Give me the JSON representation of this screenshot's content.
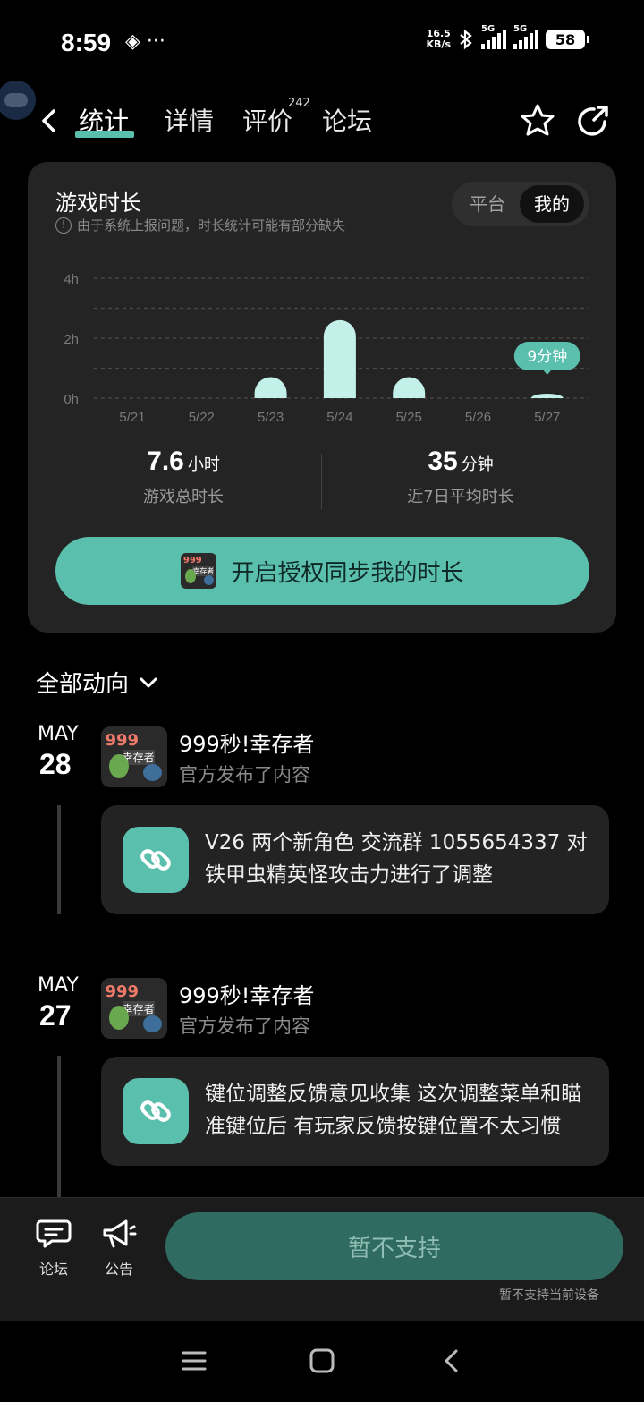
{
  "status_bar": {
    "time": "8:59",
    "left_icons": "◈ ···",
    "net_speed_value": "16.5",
    "net_speed_unit": "KB/s",
    "sim1": "5G",
    "sim2": "5G",
    "battery": "58"
  },
  "nav": {
    "tabs": [
      {
        "label": "统计",
        "active": true
      },
      {
        "label": "详情",
        "active": false
      },
      {
        "label": "评价",
        "active": false,
        "badge": "242"
      },
      {
        "label": "论坛",
        "active": false
      }
    ]
  },
  "stats_card": {
    "title": "游戏时长",
    "note": "由于系统上报问题，时长统计可能有部分缺失",
    "toggle": {
      "options": [
        "平台",
        "我的"
      ],
      "selected": "我的"
    },
    "total": {
      "value": "7.6",
      "unit": "小时",
      "label": "游戏总时长"
    },
    "average": {
      "value": "35",
      "unit": "分钟",
      "label": "近7日平均时长"
    },
    "auth_button": "开启授权同步我的时长"
  },
  "chart_data": {
    "type": "bar",
    "categories": [
      "5/21",
      "5/22",
      "5/23",
      "5/24",
      "5/25",
      "5/26",
      "5/27"
    ],
    "values": [
      0,
      0,
      0.7,
      2.6,
      0.7,
      0,
      0.15
    ],
    "y_ticks": [
      "4h",
      "2h",
      "0h"
    ],
    "ylim": [
      0,
      4
    ],
    "grid": true,
    "bar_color": "#c3f1ea",
    "highlight_label": "9分钟",
    "highlight_index": 6,
    "highlight_color": "#5bbfad"
  },
  "feed": {
    "filter_label": "全部动向",
    "posts": [
      {
        "month": "MAY",
        "day": "28",
        "game": "999秒!幸存者",
        "action": "官方发布了内容",
        "text": "V26 两个新角色 交流群 1055654337 对铁甲虫精英怪攻击力进行了调整"
      },
      {
        "month": "MAY",
        "day": "27",
        "game": "999秒!幸存者",
        "action": "官方发布了内容",
        "text": "键位调整反馈意见收集 这次调整菜单和瞄准键位后 有玩家反馈按键位置不太习惯"
      }
    ],
    "thumb_text": "999",
    "thumb_sub": "幸存者"
  },
  "bottom_bar": {
    "forum_label": "论坛",
    "notice_label": "公告",
    "main_button": "暂不支持",
    "note": "暂不支持当前设备"
  },
  "colors": {
    "accent": "#5bbfad",
    "card_bg": "#242424",
    "page_bg": "#000000"
  }
}
